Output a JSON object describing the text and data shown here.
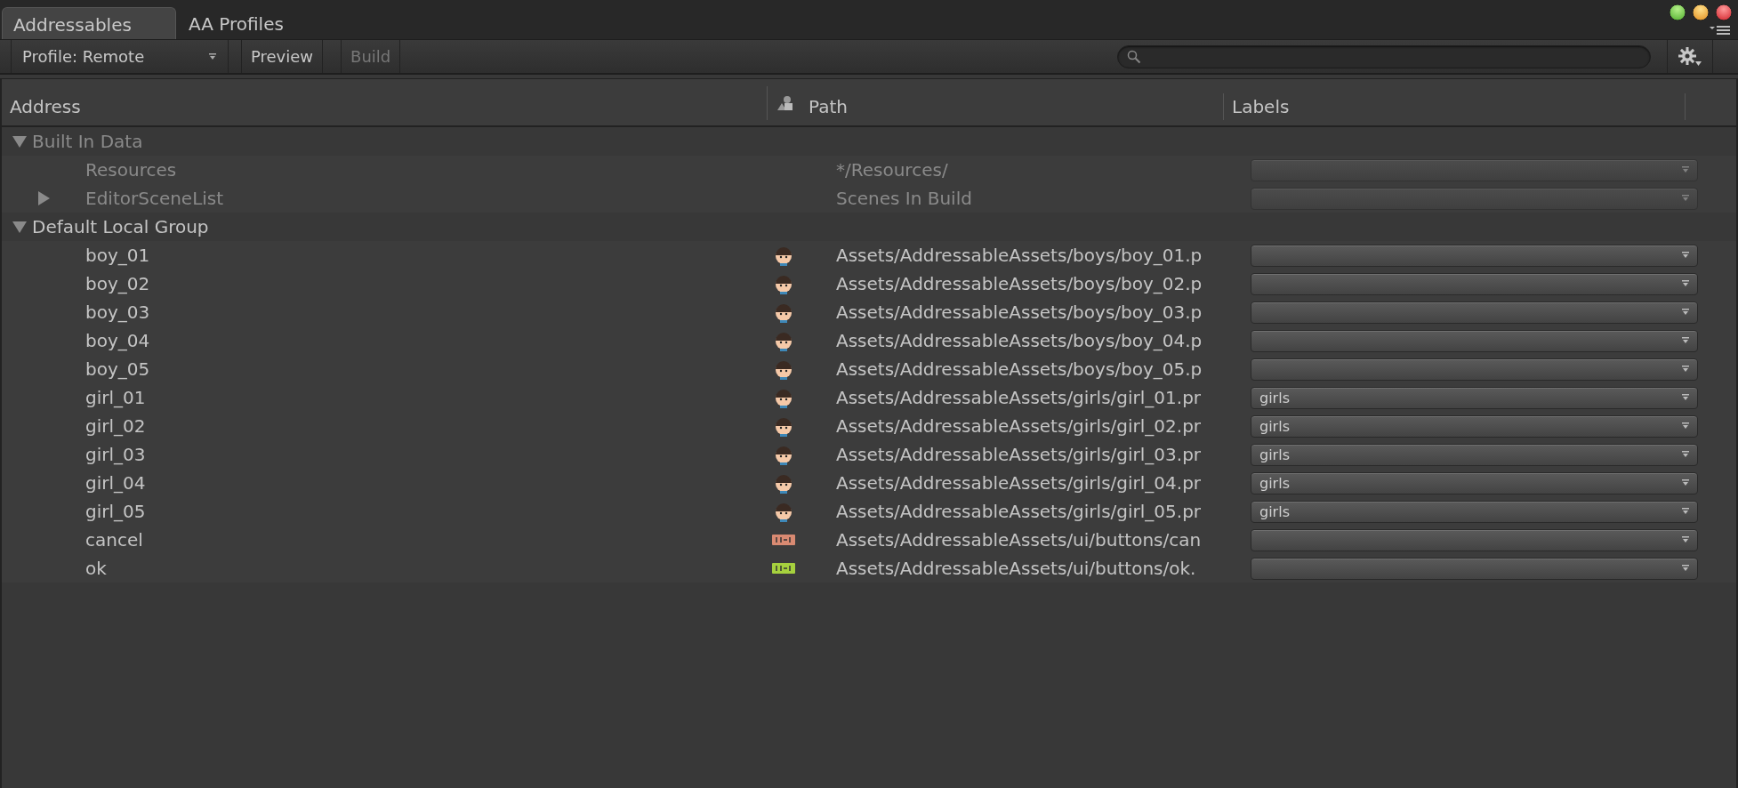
{
  "tabs": [
    {
      "label": "Addressables",
      "selected": true
    },
    {
      "label": "AA Profiles",
      "selected": false
    }
  ],
  "toolbar": {
    "profile_dropdown": "Profile: Remote",
    "buttons": [
      {
        "label": "Preview",
        "disabled": false
      },
      {
        "label": "Build",
        "disabled": true
      }
    ]
  },
  "table": {
    "columns": [
      "Address",
      "Path",
      "Labels"
    ],
    "groups": [
      {
        "name": "Built In Data",
        "expanded": true,
        "disabled": true,
        "entries": [
          {
            "kind": "plain",
            "address": "Resources",
            "path": "*/Resources/"
          },
          {
            "kind": "collapsed-folder",
            "address": "EditorSceneList",
            "path": "Scenes In Build"
          }
        ]
      },
      {
        "name": "Default Local Group",
        "expanded": true,
        "disabled": false,
        "entries": [
          {
            "kind": "face-sprite",
            "address": "boy_01",
            "path": "Assets/AddressableAssets/boys/boy_01.p"
          },
          {
            "kind": "face-sprite",
            "address": "boy_02",
            "path": "Assets/AddressableAssets/boys/boy_02.p"
          },
          {
            "kind": "face-sprite",
            "address": "boy_03",
            "path": "Assets/AddressableAssets/boys/boy_03.p"
          },
          {
            "kind": "face-sprite",
            "address": "boy_04",
            "path": "Assets/AddressableAssets/boys/boy_04.p"
          },
          {
            "kind": "face-sprite",
            "address": "boy_05",
            "path": "Assets/AddressableAssets/boys/boy_05.p"
          },
          {
            "kind": "face-sprite",
            "address": "girl_01",
            "path": "Assets/AddressableAssets/girls/girl_01.pr",
            "labels": "girls"
          },
          {
            "kind": "face-sprite",
            "address": "girl_02",
            "path": "Assets/AddressableAssets/girls/girl_02.pr",
            "labels": "girls"
          },
          {
            "kind": "face-sprite",
            "address": "girl_03",
            "path": "Assets/AddressableAssets/girls/girl_03.pr",
            "labels": "girls"
          },
          {
            "kind": "face-sprite",
            "address": "girl_04",
            "path": "Assets/AddressableAssets/girls/girl_04.pr",
            "labels": "girls"
          },
          {
            "kind": "face-sprite",
            "address": "girl_05",
            "path": "Assets/AddressableAssets/girls/girl_05.pr",
            "labels": "girls"
          },
          {
            "kind": "button-sprite",
            "color": "#d98a72",
            "address": "cancel",
            "path": "Assets/AddressableAssets/ui/buttons/can"
          },
          {
            "kind": "button-sprite",
            "color": "#a6d13e",
            "address": "ok",
            "path": "Assets/AddressableAssets/ui/buttons/ok."
          }
        ]
      }
    ]
  }
}
